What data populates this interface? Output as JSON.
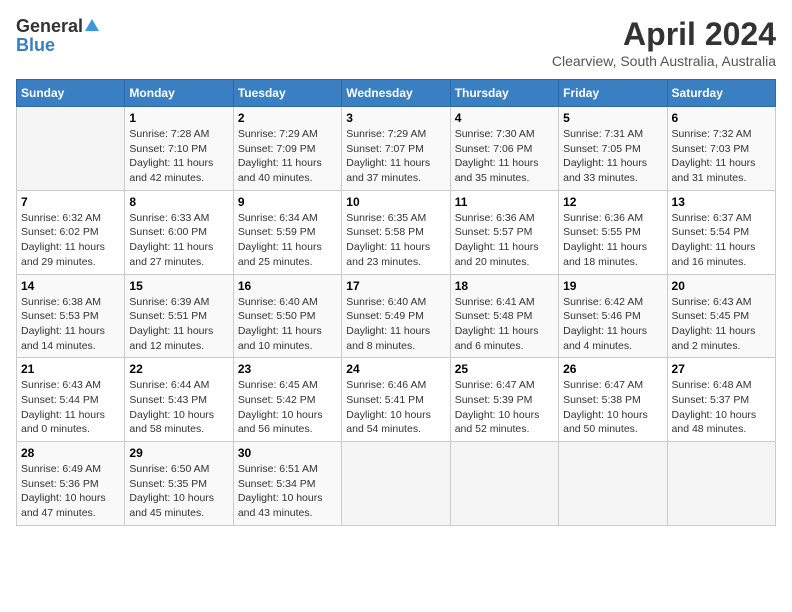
{
  "header": {
    "logo_general": "General",
    "logo_blue": "Blue",
    "month_title": "April 2024",
    "location": "Clearview, South Australia, Australia"
  },
  "days_of_week": [
    "Sunday",
    "Monday",
    "Tuesday",
    "Wednesday",
    "Thursday",
    "Friday",
    "Saturday"
  ],
  "weeks": [
    [
      {
        "day": "",
        "empty": true
      },
      {
        "day": "1",
        "sunrise": "Sunrise: 7:28 AM",
        "sunset": "Sunset: 7:10 PM",
        "daylight": "Daylight: 11 hours and 42 minutes."
      },
      {
        "day": "2",
        "sunrise": "Sunrise: 7:29 AM",
        "sunset": "Sunset: 7:09 PM",
        "daylight": "Daylight: 11 hours and 40 minutes."
      },
      {
        "day": "3",
        "sunrise": "Sunrise: 7:29 AM",
        "sunset": "Sunset: 7:07 PM",
        "daylight": "Daylight: 11 hours and 37 minutes."
      },
      {
        "day": "4",
        "sunrise": "Sunrise: 7:30 AM",
        "sunset": "Sunset: 7:06 PM",
        "daylight": "Daylight: 11 hours and 35 minutes."
      },
      {
        "day": "5",
        "sunrise": "Sunrise: 7:31 AM",
        "sunset": "Sunset: 7:05 PM",
        "daylight": "Daylight: 11 hours and 33 minutes."
      },
      {
        "day": "6",
        "sunrise": "Sunrise: 7:32 AM",
        "sunset": "Sunset: 7:03 PM",
        "daylight": "Daylight: 11 hours and 31 minutes."
      }
    ],
    [
      {
        "day": "7",
        "sunrise": "Sunrise: 6:32 AM",
        "sunset": "Sunset: 6:02 PM",
        "daylight": "Daylight: 11 hours and 29 minutes."
      },
      {
        "day": "8",
        "sunrise": "Sunrise: 6:33 AM",
        "sunset": "Sunset: 6:00 PM",
        "daylight": "Daylight: 11 hours and 27 minutes."
      },
      {
        "day": "9",
        "sunrise": "Sunrise: 6:34 AM",
        "sunset": "Sunset: 5:59 PM",
        "daylight": "Daylight: 11 hours and 25 minutes."
      },
      {
        "day": "10",
        "sunrise": "Sunrise: 6:35 AM",
        "sunset": "Sunset: 5:58 PM",
        "daylight": "Daylight: 11 hours and 23 minutes."
      },
      {
        "day": "11",
        "sunrise": "Sunrise: 6:36 AM",
        "sunset": "Sunset: 5:57 PM",
        "daylight": "Daylight: 11 hours and 20 minutes."
      },
      {
        "day": "12",
        "sunrise": "Sunrise: 6:36 AM",
        "sunset": "Sunset: 5:55 PM",
        "daylight": "Daylight: 11 hours and 18 minutes."
      },
      {
        "day": "13",
        "sunrise": "Sunrise: 6:37 AM",
        "sunset": "Sunset: 5:54 PM",
        "daylight": "Daylight: 11 hours and 16 minutes."
      }
    ],
    [
      {
        "day": "14",
        "sunrise": "Sunrise: 6:38 AM",
        "sunset": "Sunset: 5:53 PM",
        "daylight": "Daylight: 11 hours and 14 minutes."
      },
      {
        "day": "15",
        "sunrise": "Sunrise: 6:39 AM",
        "sunset": "Sunset: 5:51 PM",
        "daylight": "Daylight: 11 hours and 12 minutes."
      },
      {
        "day": "16",
        "sunrise": "Sunrise: 6:40 AM",
        "sunset": "Sunset: 5:50 PM",
        "daylight": "Daylight: 11 hours and 10 minutes."
      },
      {
        "day": "17",
        "sunrise": "Sunrise: 6:40 AM",
        "sunset": "Sunset: 5:49 PM",
        "daylight": "Daylight: 11 hours and 8 minutes."
      },
      {
        "day": "18",
        "sunrise": "Sunrise: 6:41 AM",
        "sunset": "Sunset: 5:48 PM",
        "daylight": "Daylight: 11 hours and 6 minutes."
      },
      {
        "day": "19",
        "sunrise": "Sunrise: 6:42 AM",
        "sunset": "Sunset: 5:46 PM",
        "daylight": "Daylight: 11 hours and 4 minutes."
      },
      {
        "day": "20",
        "sunrise": "Sunrise: 6:43 AM",
        "sunset": "Sunset: 5:45 PM",
        "daylight": "Daylight: 11 hours and 2 minutes."
      }
    ],
    [
      {
        "day": "21",
        "sunrise": "Sunrise: 6:43 AM",
        "sunset": "Sunset: 5:44 PM",
        "daylight": "Daylight: 11 hours and 0 minutes."
      },
      {
        "day": "22",
        "sunrise": "Sunrise: 6:44 AM",
        "sunset": "Sunset: 5:43 PM",
        "daylight": "Daylight: 10 hours and 58 minutes."
      },
      {
        "day": "23",
        "sunrise": "Sunrise: 6:45 AM",
        "sunset": "Sunset: 5:42 PM",
        "daylight": "Daylight: 10 hours and 56 minutes."
      },
      {
        "day": "24",
        "sunrise": "Sunrise: 6:46 AM",
        "sunset": "Sunset: 5:41 PM",
        "daylight": "Daylight: 10 hours and 54 minutes."
      },
      {
        "day": "25",
        "sunrise": "Sunrise: 6:47 AM",
        "sunset": "Sunset: 5:39 PM",
        "daylight": "Daylight: 10 hours and 52 minutes."
      },
      {
        "day": "26",
        "sunrise": "Sunrise: 6:47 AM",
        "sunset": "Sunset: 5:38 PM",
        "daylight": "Daylight: 10 hours and 50 minutes."
      },
      {
        "day": "27",
        "sunrise": "Sunrise: 6:48 AM",
        "sunset": "Sunset: 5:37 PM",
        "daylight": "Daylight: 10 hours and 48 minutes."
      }
    ],
    [
      {
        "day": "28",
        "sunrise": "Sunrise: 6:49 AM",
        "sunset": "Sunset: 5:36 PM",
        "daylight": "Daylight: 10 hours and 47 minutes."
      },
      {
        "day": "29",
        "sunrise": "Sunrise: 6:50 AM",
        "sunset": "Sunset: 5:35 PM",
        "daylight": "Daylight: 10 hours and 45 minutes."
      },
      {
        "day": "30",
        "sunrise": "Sunrise: 6:51 AM",
        "sunset": "Sunset: 5:34 PM",
        "daylight": "Daylight: 10 hours and 43 minutes."
      },
      {
        "day": "",
        "empty": true
      },
      {
        "day": "",
        "empty": true
      },
      {
        "day": "",
        "empty": true
      },
      {
        "day": "",
        "empty": true
      }
    ]
  ]
}
